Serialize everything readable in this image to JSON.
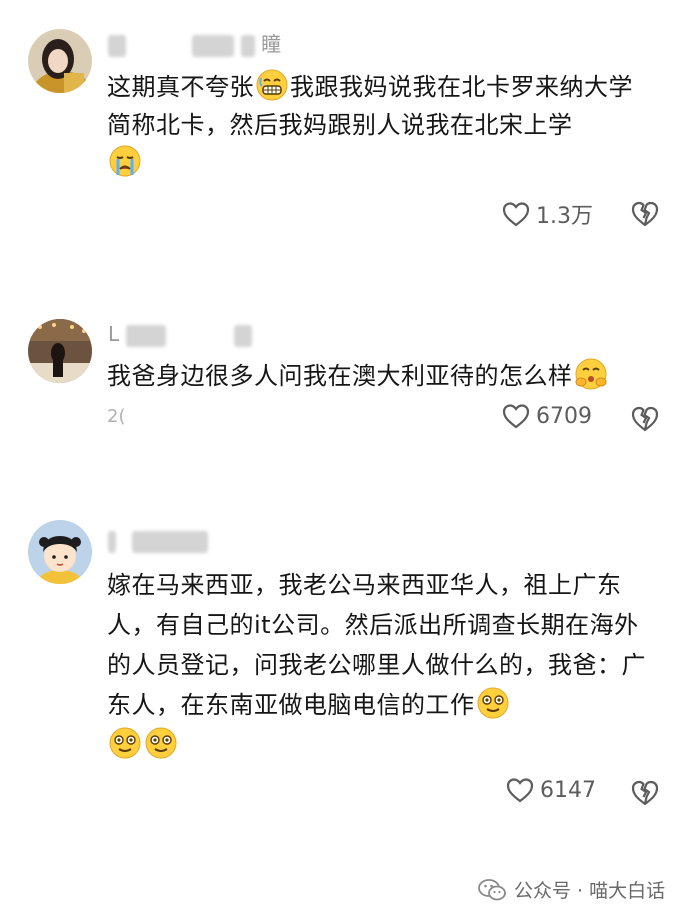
{
  "comments": [
    {
      "username_visible": "瞳",
      "text_parts": [
        "这期真不夸张",
        "我跟我妈说我在北卡罗来纳大学简称北卡，然后我妈跟别人说我在北宋上学"
      ],
      "emojis": [
        "grimace-emoji",
        "crying-emoji"
      ],
      "likes": "1.3万"
    },
    {
      "username_visible": "L",
      "text": "我爸身边很多人问我在澳大利亚待的怎么样",
      "emoji": "hug-emoji",
      "date_partial": "2(",
      "likes": "6709"
    },
    {
      "username_visible": "",
      "text": "嫁在马来西亚，我老公马来西亚华人，祖上广东人，有自己的it公司。然后派出所调查长期在海外的人员登记，问我老公哪里人做什么的，我爸：广东人，在东南亚做电脑电信的工作",
      "emojis": [
        "smile-emoji",
        "smile-emoji",
        "smile-emoji"
      ],
      "likes": "6147"
    }
  ],
  "footer": {
    "source": "公众号 · 喵大白话"
  }
}
